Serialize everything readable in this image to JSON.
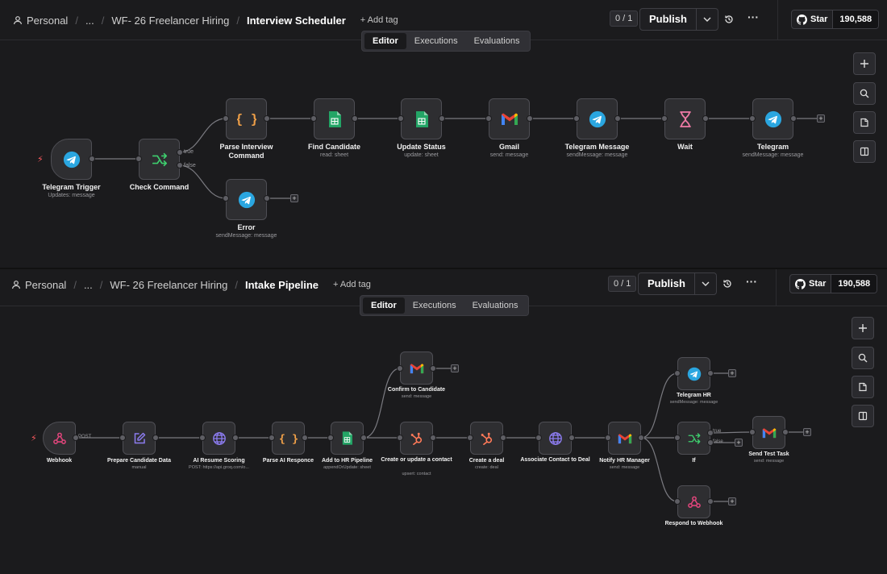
{
  "top": {
    "breadcrumb": {
      "personal": "Personal",
      "ellipsis": "...",
      "project": "WF- 26 Freelancer Hiring",
      "workflow": "Interview Scheduler"
    },
    "add_tag": "+ Add tag",
    "counter": "0 / 1",
    "publish": "Publish",
    "star": "Star",
    "star_count": "190,588",
    "more": "···",
    "tabs": [
      "Editor",
      "Executions",
      "Evaluations"
    ],
    "nodes": {
      "trigger": {
        "label": "Telegram Trigger",
        "sub": "Updates: message"
      },
      "check": {
        "label": "Check Command",
        "sub": ""
      },
      "parse": {
        "label": "Parse Interview Command",
        "sub": ""
      },
      "find": {
        "label": "Find Candidate",
        "sub": "read: sheet"
      },
      "update": {
        "label": "Update Status",
        "sub": "update: sheet"
      },
      "gmail": {
        "label": "Gmail",
        "sub": "send: message"
      },
      "tgmsg": {
        "label": "Telegram Message",
        "sub": "sendMessage: message"
      },
      "wait": {
        "label": "Wait",
        "sub": ""
      },
      "telegram": {
        "label": "Telegram",
        "sub": "sendMessage: message"
      },
      "error": {
        "label": "Error",
        "sub": "sendMessage: message"
      }
    },
    "edge_true": "true",
    "edge_false": "false"
  },
  "bottom": {
    "breadcrumb": {
      "personal": "Personal",
      "ellipsis": "...",
      "project": "WF- 26 Freelancer Hiring",
      "workflow": "Intake Pipeline"
    },
    "add_tag": "+ Add tag",
    "counter": "0 / 1",
    "publish": "Publish",
    "star": "Star",
    "star_count": "190,588",
    "more": "···",
    "tabs": [
      "Editor",
      "Executions",
      "Evaluations"
    ],
    "nodes": {
      "webhook": {
        "label": "Webhook",
        "sub": ""
      },
      "prepare": {
        "label": "Prepare Candidate Data",
        "sub": "manual"
      },
      "airesume": {
        "label": "AI Resume Scoring",
        "sub": "POST: https://api.groq.com/o..."
      },
      "parseai": {
        "label": "Parse AI Responce",
        "sub": ""
      },
      "addhr": {
        "label": "Add to HR Pipeline",
        "sub": "appendOrUpdate: sheet"
      },
      "confirm": {
        "label": "Confirm to Candidate",
        "sub": "send: message"
      },
      "contact": {
        "label": "Create or update a contact",
        "sub": "upsert: contact"
      },
      "deal": {
        "label": "Create a deal",
        "sub": "create: deal"
      },
      "assoc": {
        "label": "Associate Contact to Deal",
        "sub": ""
      },
      "notify": {
        "label": "Notify HR Manager",
        "sub": "send: message"
      },
      "tghr": {
        "label": "Telegram HR",
        "sub": "sendMessage: message"
      },
      "if": {
        "label": "If",
        "sub": ""
      },
      "testtask": {
        "label": "Send Test Task",
        "sub": "send: message"
      },
      "respond": {
        "label": "Respond to Webhook",
        "sub": ""
      }
    },
    "edge_post": "POST",
    "edge_true": "true",
    "edge_false": "false"
  },
  "colors": {
    "bg": "#1b1b1d",
    "node_bg": "#2e2e31",
    "telegram": "#2aa6e0",
    "sheets": "#23a566",
    "switch_green": "#3ecf6e",
    "code_orange": "#f0a048",
    "hubspot": "#ff7a59",
    "globe": "#8c7cf0",
    "webhook": "#e0457b",
    "wait_pink": "#f07ba6",
    "trigger_bolt": "#ff5a5f"
  },
  "icons": {
    "telegram": "telegram-icon",
    "switch": "switch-icon",
    "code": "code-braces-icon",
    "sheets": "google-sheets-icon",
    "gmail": "gmail-icon",
    "wait": "hourglass-icon",
    "webhook": "webhook-icon",
    "edit": "edit-icon",
    "globe": "globe-icon",
    "hubspot": "hubspot-icon"
  }
}
